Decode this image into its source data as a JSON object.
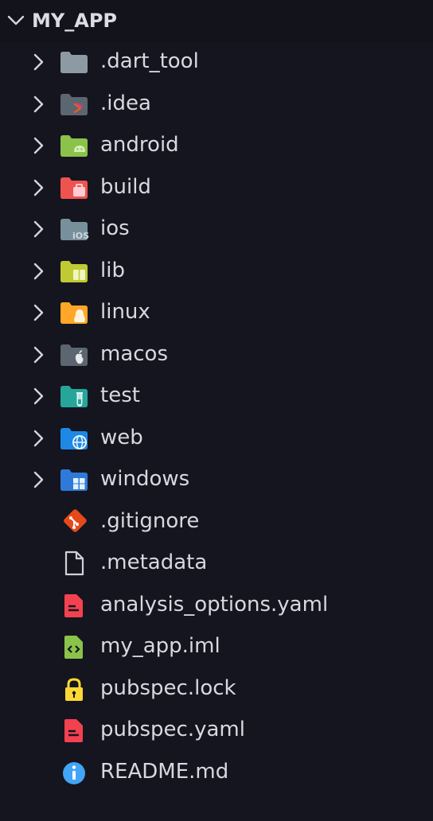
{
  "explorer": {
    "title": "MY_APP",
    "items": [
      {
        "label": ".dart_tool",
        "kind": "folder",
        "icon": "folder-icon",
        "color": "#8d9aa3"
      },
      {
        "label": ".idea",
        "kind": "folder",
        "icon": "folder-idea-icon",
        "color": "#5b6670"
      },
      {
        "label": "android",
        "kind": "folder",
        "icon": "folder-android-icon",
        "color": "#8bc34a"
      },
      {
        "label": "build",
        "kind": "folder",
        "icon": "folder-build-icon",
        "color": "#ef5350"
      },
      {
        "label": "ios",
        "kind": "folder",
        "icon": "folder-ios-icon",
        "color": "#78909c"
      },
      {
        "label": "lib",
        "kind": "folder",
        "icon": "folder-lib-icon",
        "color": "#c0ca33"
      },
      {
        "label": "linux",
        "kind": "folder",
        "icon": "folder-linux-icon",
        "color": "#ffa726"
      },
      {
        "label": "macos",
        "kind": "folder",
        "icon": "folder-macos-icon",
        "color": "#5b6670"
      },
      {
        "label": "test",
        "kind": "folder",
        "icon": "folder-test-icon",
        "color": "#26a69a"
      },
      {
        "label": "web",
        "kind": "folder",
        "icon": "folder-web-icon",
        "color": "#1e88e5"
      },
      {
        "label": "windows",
        "kind": "folder",
        "icon": "folder-windows-icon",
        "color": "#2f7ad9"
      },
      {
        "label": ".gitignore",
        "kind": "file",
        "icon": "git-icon",
        "color": "#e64a19"
      },
      {
        "label": ".metadata",
        "kind": "file",
        "icon": "file-icon",
        "color": "#cfd3d8"
      },
      {
        "label": "analysis_options.yaml",
        "kind": "file",
        "icon": "yaml-icon",
        "color": "#f44150"
      },
      {
        "label": "my_app.iml",
        "kind": "file",
        "icon": "xml-icon",
        "color": "#8bc34a"
      },
      {
        "label": "pubspec.lock",
        "kind": "file",
        "icon": "lock-icon",
        "color": "#fdd835"
      },
      {
        "label": "pubspec.yaml",
        "kind": "file",
        "icon": "yaml-icon",
        "color": "#f44150"
      },
      {
        "label": "README.md",
        "kind": "file",
        "icon": "info-icon",
        "color": "#42a5f5"
      }
    ]
  }
}
